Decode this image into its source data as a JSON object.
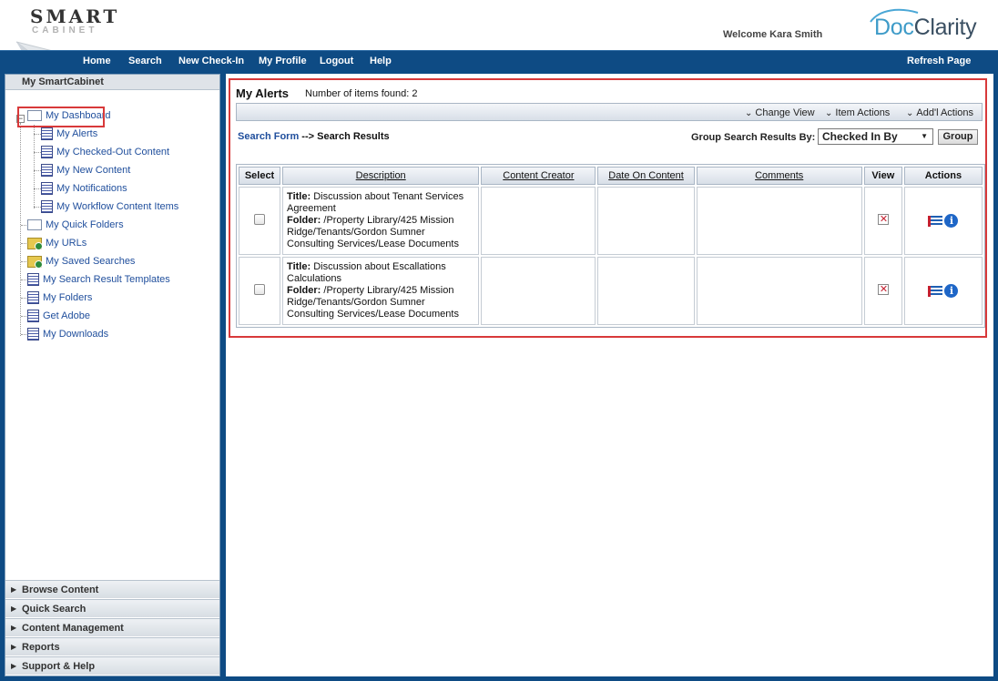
{
  "header": {
    "logo_line1": "SMART",
    "logo_line2": "CABINET",
    "welcome": "Welcome Kara Smith",
    "brand_doc": "Doc",
    "brand_clarity": "Clarity"
  },
  "nav": {
    "items": [
      "Home",
      "Search",
      "New Check-In",
      "My Profile",
      "Logout",
      "Help"
    ],
    "refresh": "Refresh Page"
  },
  "sidebar": {
    "title": "My SmartCabinet",
    "tree": [
      {
        "label": "My Dashboard",
        "icon": "folder-open-icon"
      },
      {
        "label": "My Alerts",
        "icon": "page-icon"
      },
      {
        "label": "My Checked-Out Content",
        "icon": "page-icon"
      },
      {
        "label": "My New Content",
        "icon": "page-icon"
      },
      {
        "label": "My Notifications",
        "icon": "page-icon"
      },
      {
        "label": "My Workflow Content Items",
        "icon": "page-icon"
      },
      {
        "label": "My Quick Folders",
        "icon": "folder-open-icon"
      },
      {
        "label": "My URLs",
        "icon": "folder-link-icon"
      },
      {
        "label": "My Saved Searches",
        "icon": "folder-search-icon"
      },
      {
        "label": "My Search Result Templates",
        "icon": "page-icon"
      },
      {
        "label": "My Folders",
        "icon": "page-icon"
      },
      {
        "label": "Get Adobe",
        "icon": "page-icon"
      },
      {
        "label": "My Downloads",
        "icon": "page-icon"
      }
    ],
    "bottom": [
      "Browse Content",
      "Quick Search",
      "Content Management",
      "Reports",
      "Support & Help"
    ]
  },
  "main": {
    "title": "My Alerts",
    "count_label": "Number of items found: 2",
    "actions": [
      "Change View",
      "Item Actions",
      "Add'l Actions"
    ],
    "crumb_link": "Search Form",
    "crumb_rest": " --> Search Results",
    "group_label": "Group Search Results By:",
    "group_value": "Checked In By",
    "group_button": "Group",
    "columns": [
      "Select",
      "Description",
      "Content Creator",
      "Date On Content",
      "Comments",
      "View",
      "Actions"
    ],
    "rows": [
      {
        "title_label": "Title:",
        "title": "Discussion about Tenant Services Agreement",
        "folder_label": "Folder:",
        "folder": "/Property Library/425 Mission Ridge/Tenants/Gordon Sumner Consulting Services/Lease Documents"
      },
      {
        "title_label": "Title:",
        "title": "Discussion about Escallations Calculations",
        "folder_label": "Folder:",
        "folder": "/Property Library/425 Mission Ridge/Tenants/Gordon Sumner Consulting Services/Lease Documents"
      }
    ]
  },
  "colors": {
    "nav_blue": "#0e4b84",
    "highlight_red": "#d8393a",
    "link_blue": "#1f4e9c"
  }
}
